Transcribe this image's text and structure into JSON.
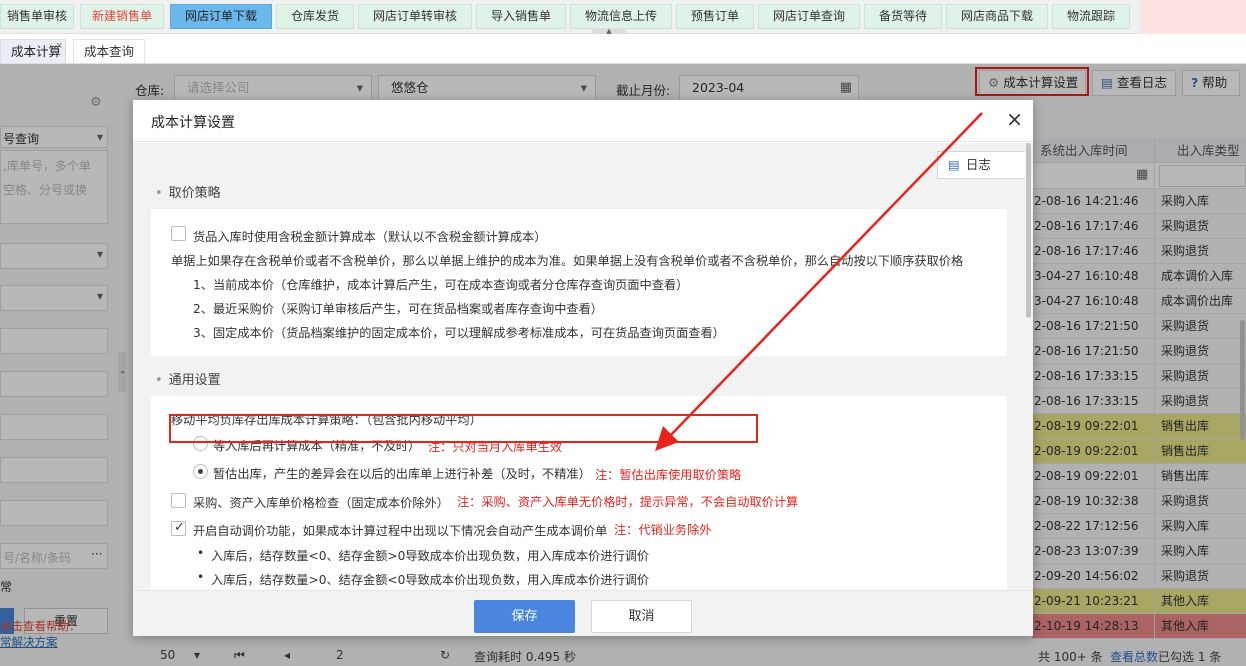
{
  "topnav": {
    "items": [
      {
        "label": "销售单审核",
        "style": "green"
      },
      {
        "label": "新建销售单",
        "style": "red"
      },
      {
        "label": "网店订单下载",
        "style": "blue"
      },
      {
        "label": "仓库发货",
        "style": "green"
      },
      {
        "label": "网店订单转审核",
        "style": "green"
      },
      {
        "label": "导入销售单",
        "style": "green"
      },
      {
        "label": "物流信息上传",
        "style": "green"
      },
      {
        "label": "预售订单",
        "style": "green"
      },
      {
        "label": "网店订单查询",
        "style": "green"
      },
      {
        "label": "备货等待",
        "style": "green"
      },
      {
        "label": "网店商品下载",
        "style": "green"
      },
      {
        "label": "物流跟踪",
        "style": "green"
      }
    ]
  },
  "tabs": {
    "active": "成本计算",
    "active_close": "×",
    "second": "成本查询"
  },
  "left_panel": {
    "query_select": "号查询",
    "textarea_line1": ",库单号，多个单",
    "textarea_line2": "空格、分号或换",
    "goods_input_placeholder": "号/名称/条码",
    "dots": "···",
    "abnormal_label": "常",
    "reset_button": "重置",
    "hint_text": "点击查看帮助：",
    "hint_link": "常解决方案"
  },
  "filters": {
    "warehouse_label": "仓库:",
    "company_placeholder": "请选择公司",
    "warehouse_value": "悠悠仓",
    "month_label": "截止月份:",
    "month_value": "2023-04"
  },
  "toolbar": {
    "settings_label": "成本计算设置",
    "log_label": "查看日志",
    "help_label": "帮助",
    "help_icon": "?"
  },
  "grid": {
    "headers": [
      "系统出入库时间",
      "出入库类型"
    ],
    "rows": [
      {
        "time": "2-08-16 14:21:46",
        "type": "采购入库",
        "color": "white"
      },
      {
        "time": "2-08-16 17:17:46",
        "type": "采购退货",
        "color": "white"
      },
      {
        "time": "2-08-16 17:17:46",
        "type": "采购退货",
        "color": "white"
      },
      {
        "time": "3-04-27 16:10:48",
        "type": "成本调价入库",
        "color": "white"
      },
      {
        "time": "3-04-27 16:10:48",
        "type": "成本调价出库",
        "color": "white"
      },
      {
        "time": "2-08-16 17:21:50",
        "type": "采购退货",
        "color": "white"
      },
      {
        "time": "2-08-16 17:21:50",
        "type": "采购退货",
        "color": "white"
      },
      {
        "time": "2-08-16 17:33:15",
        "type": "采购退货",
        "color": "white"
      },
      {
        "time": "2-08-16 17:33:15",
        "type": "采购退货",
        "color": "white"
      },
      {
        "time": "2-08-19 09:22:01",
        "type": "销售出库",
        "color": "yellow"
      },
      {
        "time": "2-08-19 09:22:01",
        "type": "销售出库",
        "color": "yellow"
      },
      {
        "time": "2-08-19 09:22:01",
        "type": "销售出库",
        "color": "white"
      },
      {
        "time": "2-08-19 10:32:38",
        "type": "采购退货",
        "color": "white"
      },
      {
        "time": "2-08-22 17:12:56",
        "type": "采购入库",
        "color": "white"
      },
      {
        "time": "2-08-23 13:07:39",
        "type": "采购入库",
        "color": "white"
      },
      {
        "time": "2-09-20 14:56:02",
        "type": "采购退货",
        "color": "white"
      },
      {
        "time": "2-09-21 10:23:21",
        "type": "其他入库",
        "color": "yellow"
      },
      {
        "time": "2-10-19 14:28:13",
        "type": "其他入库",
        "color": "red"
      }
    ]
  },
  "pager": {
    "page_size": "50",
    "page": "2",
    "query_time": "查询耗时 0.495 秒",
    "total": "共 100+ 条",
    "total_link": "查看总数",
    "selected": "已勾选 1 条"
  },
  "modal": {
    "title": "成本计算设置",
    "close": "×",
    "log_button": "日志",
    "section_price": "取价策略",
    "price_checkbox": "货品入库时使用含税金额计算成本（默认以不含税金额计算成本）",
    "price_desc": "单据上如果存在含税单价或者不含税单价，那么以单据上维护的成本为准。如果单据上没有含税单价或者不含税单价，那么自动按以下顺序获取价格",
    "price_rule1": "1、当前成本价（仓库维护，成本计算后产生，可在成本查询或者分仓库存查询页面中查看）",
    "price_rule2": "2、最近采购价（采购订单审核后产生，可在货品档案或者库存查询中查看）",
    "price_rule3": "3、固定成本价（货品档案维护的固定成本价，可以理解成参考标准成本，可在货品查询页面查看）",
    "section_general": "通用设置",
    "strategy_label": "移动平均负库存出库成本计算策略：（包含批内移动平均）",
    "radio1_label": "等入库后再计算成本（精准，不及时）",
    "radio1_note": "注：只对当月入库单生效",
    "radio2_label": "暂估出库，产生的差异会在以后的出库单上进行补差（及时，不精准）",
    "radio2_note": "注：暂估出库使用取价策略",
    "check_purchase_label": "采购、资产入库单价格检查（固定成本价除外）",
    "check_purchase_note": "注：采购、资产入库单无价格时，提示异常，不会自动取价计算",
    "check_adjust_label": "开启自动调价功能，如果成本计算过程中出现以下情况会自动产生成本调价单",
    "check_adjust_note": "注：代销业务除外",
    "bullet1": "入库后，结存数量<0、结存金额>0导致成本价出现负数，用入库成本价进行调价",
    "bullet2": "入库后，结存数量>0、结存金额<0导致成本价出现负数，用入库成本价进行调价",
    "save": "保存",
    "cancel": "取消"
  },
  "colors": {
    "primary": "#4a86e0",
    "highlight_red": "#e8231c",
    "note_red": "#e8231c",
    "row_yellow": "#e8e68a",
    "row_red": "#ee8a8a",
    "nav_green": "#dff3e8",
    "nav_blue": "#6ab8ec"
  }
}
